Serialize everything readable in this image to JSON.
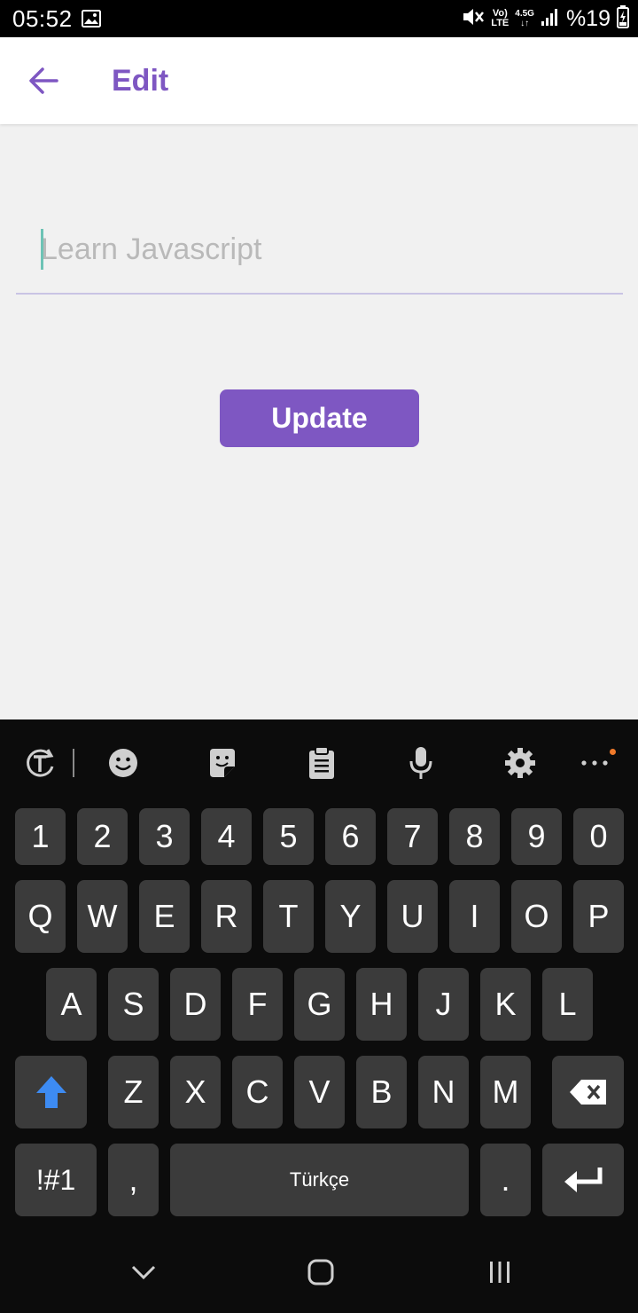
{
  "status_bar": {
    "time": "05:52",
    "lte_top": "Vo)",
    "lte_bottom": "LTE",
    "network": "4.5G",
    "battery_text": "%19"
  },
  "app_bar": {
    "title": "Edit"
  },
  "edit": {
    "value": "",
    "placeholder": "Learn Javascript"
  },
  "update_button": {
    "label": "Update"
  },
  "keyboard": {
    "toolbar_icons": [
      "translate-icon",
      "emoji-icon",
      "sticker-icon",
      "clipboard-icon",
      "mic-icon",
      "gear-icon",
      "more-icon"
    ],
    "number_row": [
      "1",
      "2",
      "3",
      "4",
      "5",
      "6",
      "7",
      "8",
      "9",
      "0"
    ],
    "row1": [
      "Q",
      "W",
      "E",
      "R",
      "T",
      "Y",
      "U",
      "I",
      "O",
      "P"
    ],
    "row2": [
      "A",
      "S",
      "D",
      "F",
      "G",
      "H",
      "J",
      "K",
      "L"
    ],
    "row3": [
      "Z",
      "X",
      "C",
      "V",
      "B",
      "N",
      "M"
    ],
    "symbols_label": "!#1",
    "comma_label": ",",
    "space_label": "Türkçe",
    "period_label": "."
  },
  "colors": {
    "accent": "#7e57c2",
    "shift_blue": "#3d8bf2",
    "keyboard_bg": "#0c0c0c",
    "key_bg": "#3b3b3b"
  }
}
